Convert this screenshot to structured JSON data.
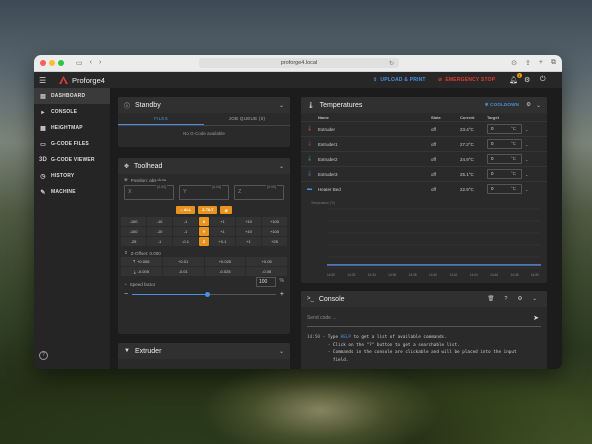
{
  "browser": {
    "url": "proforge4.local"
  },
  "app": {
    "name": "Proforge4",
    "upload_label": "UPLOAD & PRINT",
    "estop_label": "EMERGENCY STOP",
    "notification_count": "1"
  },
  "sidebar": {
    "items": [
      {
        "label": "DASHBOARD",
        "icon": "dashboard-icon",
        "active": true
      },
      {
        "label": "CONSOLE",
        "icon": "console-icon"
      },
      {
        "label": "HEIGHTMAP",
        "icon": "heightmap-icon"
      },
      {
        "label": "G-CODE FILES",
        "icon": "files-icon"
      },
      {
        "label": "G-CODE VIEWER",
        "icon": "3d-icon"
      },
      {
        "label": "HISTORY",
        "icon": "history-icon"
      },
      {
        "label": "MACHINE",
        "icon": "wrench-icon"
      }
    ]
  },
  "standby": {
    "title": "Standby",
    "tab_files": "FILES",
    "tab_queue": "JOB QUEUE (0)",
    "empty": "No G-Code available"
  },
  "toolhead": {
    "title": "Toolhead",
    "position_label": "Position: absolute",
    "axes": [
      {
        "name": "X",
        "value": "0.00"
      },
      {
        "name": "Y",
        "value": "0.00"
      },
      {
        "name": "Z",
        "value": "0.00"
      }
    ],
    "home_all": "ALL",
    "z_tilt": "Z-TILT",
    "jog_rows": [
      [
        "-100",
        "-10",
        "-1",
        "X",
        "+1",
        "+10",
        "+100"
      ],
      [
        "-100",
        "-10",
        "-1",
        "Y",
        "+1",
        "+10",
        "+100"
      ],
      [
        "-25",
        "-1",
        "-0.1",
        "Z",
        "+0.1",
        "+1",
        "+25"
      ]
    ],
    "zoffset_label": "Z-Offset: 0.000",
    "zoffset_rows": [
      [
        "+0.005",
        "+0.01",
        "+0.025",
        "+0.05"
      ],
      [
        "-0.005",
        "-0.01",
        "-0.025",
        "-0.05"
      ]
    ],
    "speed_label": "Speed factor",
    "speed_value": "100",
    "speed_unit": "%",
    "speed_fraction": 0.52
  },
  "extruder": {
    "title": "Extruder"
  },
  "temperatures": {
    "title": "Temperatures",
    "cooldown": "COOLDOWN",
    "columns": [
      "Name",
      "State",
      "Current",
      "Target"
    ],
    "rows": [
      {
        "name": "Extruder",
        "state": "off",
        "current": "23.4°C",
        "target": "0",
        "unit": "°C",
        "color": "#b04a3a",
        "icon": "thermometer-icon"
      },
      {
        "name": "Extruder1",
        "state": "off",
        "current": "27.2°C",
        "target": "0",
        "unit": "°C",
        "color": "#7a3a7a",
        "icon": "thermometer-icon"
      },
      {
        "name": "Extruder2",
        "state": "off",
        "current": "24.9°C",
        "target": "0",
        "unit": "°C",
        "color": "#3a8a7a",
        "icon": "thermometer-icon"
      },
      {
        "name": "Extruder3",
        "state": "off",
        "current": "25.1°C",
        "target": "0",
        "unit": "°C",
        "color": "#4a6a9a",
        "icon": "thermometer-icon"
      },
      {
        "name": "Heater Bed",
        "state": "off",
        "current": "22.9°C",
        "target": "0",
        "unit": "°C",
        "color": "#4a90e2",
        "icon": "bed-icon"
      }
    ],
    "chart_ylabel": "Temperature [°C]",
    "chart_xticks": [
      "14:30",
      "14:32",
      "14:34",
      "14:36",
      "14:38",
      "14:40",
      "14:42",
      "14:44",
      "14:46",
      "14:48",
      "14:50"
    ]
  },
  "console": {
    "title": "Console",
    "placeholder": "Send code ...",
    "lines": [
      {
        "ts": "14:50",
        "pre": "- Type ",
        "kw": "HELP",
        "post": " to get a list of available commands."
      },
      {
        "ts": "",
        "pre": "  - Click on the \"?\" button to get a searchable list.",
        "kw": "",
        "post": ""
      },
      {
        "ts": "",
        "pre": "  - Commands in the console are clickable and will be placed into the input",
        "kw": "",
        "post": ""
      },
      {
        "ts": "",
        "pre": "    field.",
        "kw": "",
        "post": ""
      }
    ]
  }
}
